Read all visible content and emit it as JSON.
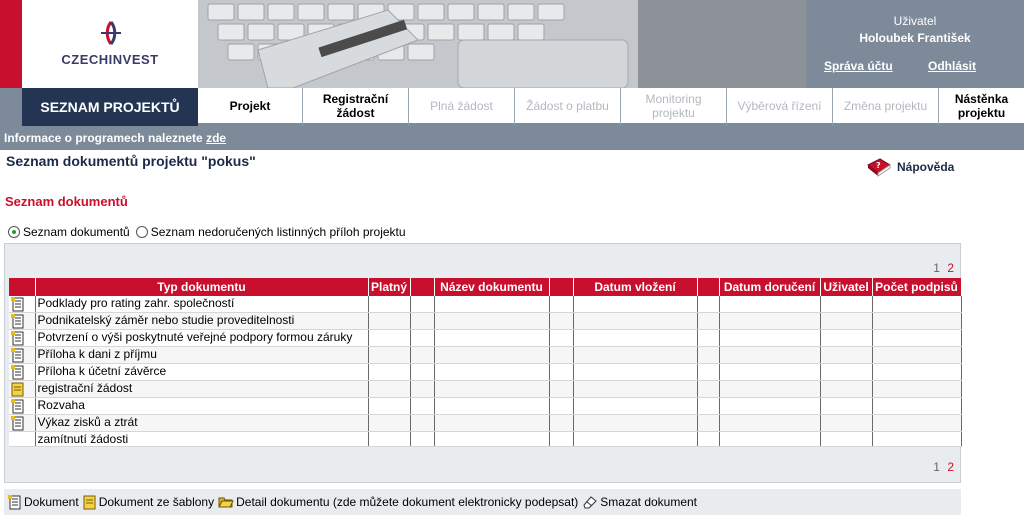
{
  "header": {
    "logo_text": "CZECHINVEST",
    "user_caption": "Uživatel",
    "user_name": "Holoubek František",
    "account_link": "Správa účtu",
    "logout_link": "Odhlásit"
  },
  "nav": {
    "title": "SEZNAM PROJEKTŮ",
    "items": [
      {
        "label": "Projekt"
      },
      {
        "label": "Registrační žádost"
      },
      {
        "label": "Plná žádost"
      },
      {
        "label": "Žádost o platbu"
      },
      {
        "label": "Monitoring projektu"
      },
      {
        "label": "Výběrová řízení"
      },
      {
        "label": "Změna projektu"
      },
      {
        "label": "Nástěnka projektu"
      }
    ]
  },
  "info_bar": {
    "text": "Informace o programech naleznete ",
    "link": "zde"
  },
  "page_title": "Seznam dokumentů projektu  \"pokus\"",
  "help_label": "Nápověda",
  "section_title": "Seznam dokumentů",
  "radios": [
    {
      "label": "Seznam dokumentů",
      "checked": true
    },
    {
      "label": "Seznam nedoručených listinných příloh projektu",
      "checked": false
    }
  ],
  "pagination": {
    "pages": [
      "1",
      "2"
    ],
    "current": "1"
  },
  "table": {
    "columns": [
      "Typ dokumentu",
      "Platný",
      "Název dokumentu",
      "Datum vložení",
      "Datum doručení",
      "Uživatel",
      "Počet podpisů"
    ],
    "rows": [
      {
        "icon": "document-icon",
        "type": "Podklady pro rating zahr. společností"
      },
      {
        "icon": "document-icon",
        "type": "Podnikatelský záměr nebo studie proveditelnosti"
      },
      {
        "icon": "document-icon",
        "type": "Potvrzení o výši poskytnuté veřejné podpory formou záruky"
      },
      {
        "icon": "document-icon",
        "type": "Příloha k dani z příjmu"
      },
      {
        "icon": "document-icon",
        "type": "Příloha k účetní závěrce"
      },
      {
        "icon": "template-icon",
        "type": "registrační žádost"
      },
      {
        "icon": "document-icon",
        "type": "Rozvaha"
      },
      {
        "icon": "document-icon",
        "type": "Výkaz zisků a ztrát"
      },
      {
        "icon": "",
        "type": "zamítnutí žádosti"
      }
    ]
  },
  "legend": {
    "document": "Dokument",
    "template_document": "Dokument ze šablony",
    "detail": "Detail dokumentu (zde můžete dokument elektronicky podepsat)",
    "delete": "Smazat dokument"
  },
  "colors": {
    "brand_red": "#c8102e",
    "nav_dark": "#233553",
    "grey_blue": "#7d8a9a"
  }
}
